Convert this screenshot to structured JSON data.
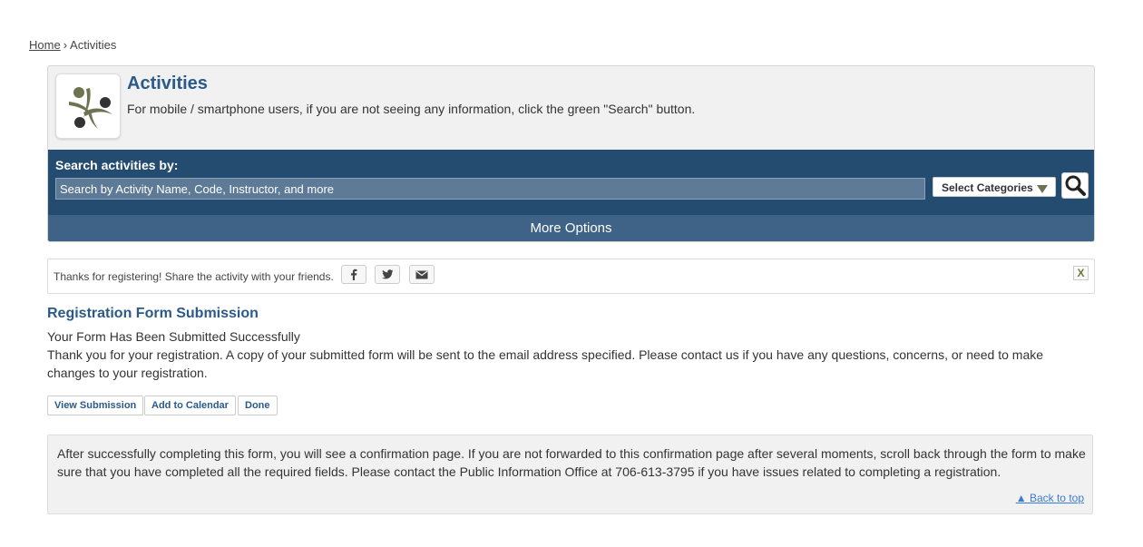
{
  "breadcrumb": {
    "home": "Home",
    "separator": "›",
    "current": "Activities"
  },
  "header": {
    "title": "Activities",
    "intro": "For mobile / smartphone users, if you are not seeing any information, click the green \"Search\" button."
  },
  "search": {
    "label": "Search activities by:",
    "placeholder": "Search by Activity Name, Code, Instructor, and more",
    "categories_label": "Select Categories",
    "more_options": "More Options"
  },
  "share": {
    "text": "Thanks for registering! Share the activity with your friends.",
    "close": "X"
  },
  "registration": {
    "title": "Registration Form Submission",
    "status": "Your Form Has Been Submitted Successfully",
    "message": "Thank you for your registration. A copy of your submitted form will be sent to the email address specified. Please contact us if you have any questions, concerns, or need to make changes to your registration.",
    "buttons": {
      "view": "View Submission",
      "calendar": "Add to Calendar",
      "done": "Done"
    }
  },
  "info": {
    "text": "After successfully completing this form, you will see a confirmation page. If you are not forwarded to this confirmation page after several moments, scroll back through the form to make sure that you have completed all the required fields. Please contact the Public Information Office at 706-613-3795 if you have issues related to completing a registration.",
    "back_to_top": "▲ Back to top"
  },
  "colors": {
    "heading_blue": "#2a5a8a",
    "search_panel": "#234c70",
    "more_options_bar": "#3e6386",
    "logo_green": "#6b7350",
    "link_blue": "#3a7bd5"
  },
  "icons": [
    "people-logo-icon",
    "search-icon",
    "facebook-icon",
    "twitter-icon",
    "email-icon",
    "close-icon",
    "dropdown-arrow-icon"
  ]
}
